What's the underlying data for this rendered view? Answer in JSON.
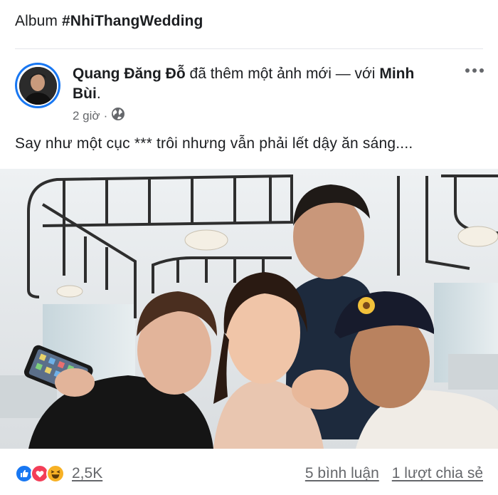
{
  "album": {
    "label": "Album",
    "name": "#NhiThangWedding"
  },
  "post": {
    "author": "Quang Đăng Đỗ",
    "action_text": "đã thêm một ảnh mới — với",
    "tagged": "Minh Bùi",
    "period": ".",
    "time": "2 giờ",
    "separator": "·",
    "privacy_icon": "globe-icon",
    "caption": "Say như một cục *** trôi nhưng vẫn phải lết dậy ăn sáng....",
    "photo_icon": "photo"
  },
  "footer": {
    "reaction_icons": [
      "like-icon",
      "love-icon",
      "haha-icon"
    ],
    "reaction_count": "2,5K",
    "comments": "5 bình luận",
    "shares": "1 lượt chia sẻ"
  },
  "colors": {
    "brand": "#1877f2",
    "love": "#f33e58",
    "haha": "#f7b125",
    "secondary_text": "#65676b"
  }
}
